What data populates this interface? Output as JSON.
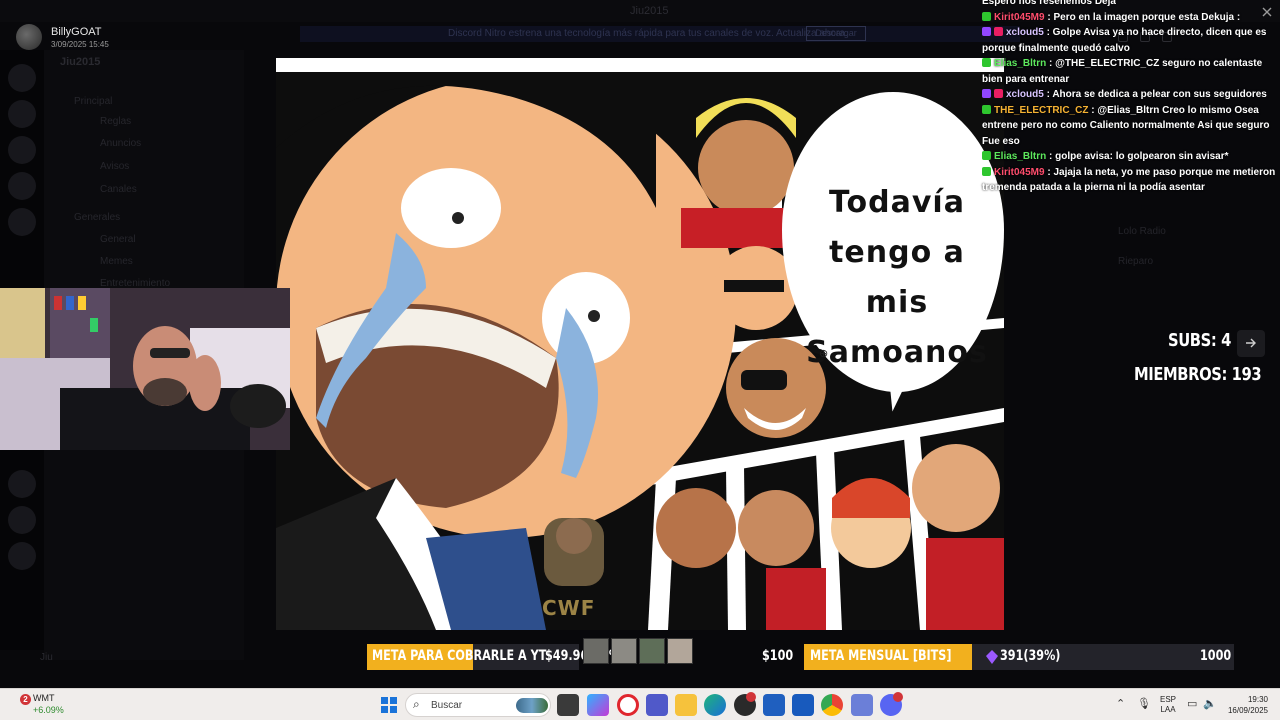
{
  "colors": {
    "goal_accent": "#f2b01e",
    "chat_green_user": "#5de85d",
    "chat_red_user": "#ff4d6d",
    "chat_purple_user": "#d8c4ff",
    "taskbar_bg": "#f0edeb"
  },
  "background_app": {
    "window_title": "Jiu2015",
    "banner_text": "Discord Nitro estrena una tecnología más rápida para tus canales de voz. Actualiza ahora.",
    "banner_button": "Descargar",
    "guild_name": "Jiu2015",
    "channels": [
      "Principal",
      "Reglas",
      "Anuncios",
      "Avisos",
      "Canales",
      "Generales",
      "General",
      "Memes",
      "Entretenimiento"
    ],
    "members": [
      "Lolo Radio",
      "Rieparo"
    ],
    "user_name": "Jiu"
  },
  "stream": {
    "streamer_name": "BillyGOAT",
    "stream_date": "3/09/2025 15:45",
    "corner_icon": "close-icon"
  },
  "comic": {
    "speech_bubble_lines": [
      "Todavía",
      "tengo a mis",
      "Samoanos"
    ],
    "logo_text": "CWF",
    "cursor_icon": "magnifier-icon"
  },
  "chat": {
    "messages": [
      {
        "user": "",
        "text": "Espero nos reseñemos Deja",
        "badges": [],
        "user_color": "#ffffff"
      },
      {
        "user": "Kirit045M9",
        "text": ": Pero en la imagen porque esta Dekuja :",
        "badges": [
          "#2ec62e"
        ],
        "user_color": "#ff4d6d"
      },
      {
        "user": "xcloud5",
        "text": ": Golpe Avisa ya no hace directo, dicen que es porque finalmente quedó calvo",
        "badges": [
          "#9146ff",
          "#e91e63"
        ],
        "user_color": "#d8c4ff"
      },
      {
        "user": "Elias_Bltrn",
        "text": ": @THE_ELECTRIC_CZ seguro no calentaste bien para entrenar",
        "badges": [
          "#2ec62e"
        ],
        "user_color": "#5de85d"
      },
      {
        "user": "xcloud5",
        "text": ": Ahora se dedica a pelear con sus seguidores",
        "badges": [
          "#9146ff",
          "#e91e63"
        ],
        "user_color": "#d8c4ff"
      },
      {
        "user": "THE_ELECTRIC_CZ",
        "text": ": @Elias_Bltrn Creo lo mismo Osea entrene pero no como Caliento normalmente Asi que seguro Fue eso",
        "badges": [
          "#2ec62e"
        ],
        "user_color": "#f5b233"
      },
      {
        "user": "Elias_Bltrn",
        "text": ": golpe avisa: lo golpearon sin avisar*",
        "badges": [
          "#2ec62e"
        ],
        "user_color": "#5de85d"
      },
      {
        "user": "Kirit045M9",
        "text": ": Jajaja la neta, yo me paso porque me metieron tremenda patada a la pierna ni la podía asentar",
        "badges": [
          "#2ec62e"
        ],
        "user_color": "#ff4d6d"
      }
    ]
  },
  "stats": {
    "subs_label": "SUBS: 4",
    "members_label": "MIEMBROS: 193",
    "next_icon": "arrow-right-icon"
  },
  "goals": {
    "yt": {
      "label": "META PARA COBRARLE A YT",
      "value": "$49.96(50%)",
      "target": "$100",
      "progress": 0.5
    },
    "bits": {
      "label": "META MENSUAL [BITS]",
      "value": "391(39%)",
      "target": "1000",
      "progress": 0.39,
      "icon": "bits-gem-icon"
    }
  },
  "taskbar": {
    "stock_badge": "2",
    "stock_name": "WMT",
    "stock_change": "+6.09%",
    "search_placeholder": "Buscar",
    "apps": [
      "file-explorer-icon",
      "copilot-icon",
      "opera-icon",
      "teams-icon",
      "folder-icon",
      "edge-icon",
      "obs-icon",
      "store-icon",
      "word-icon",
      "chrome-icon",
      "stack-icon",
      "discord-icon"
    ],
    "lang_line1": "ESP",
    "lang_line2": "LAA",
    "time": "19:30",
    "date": "16/09/2025"
  }
}
